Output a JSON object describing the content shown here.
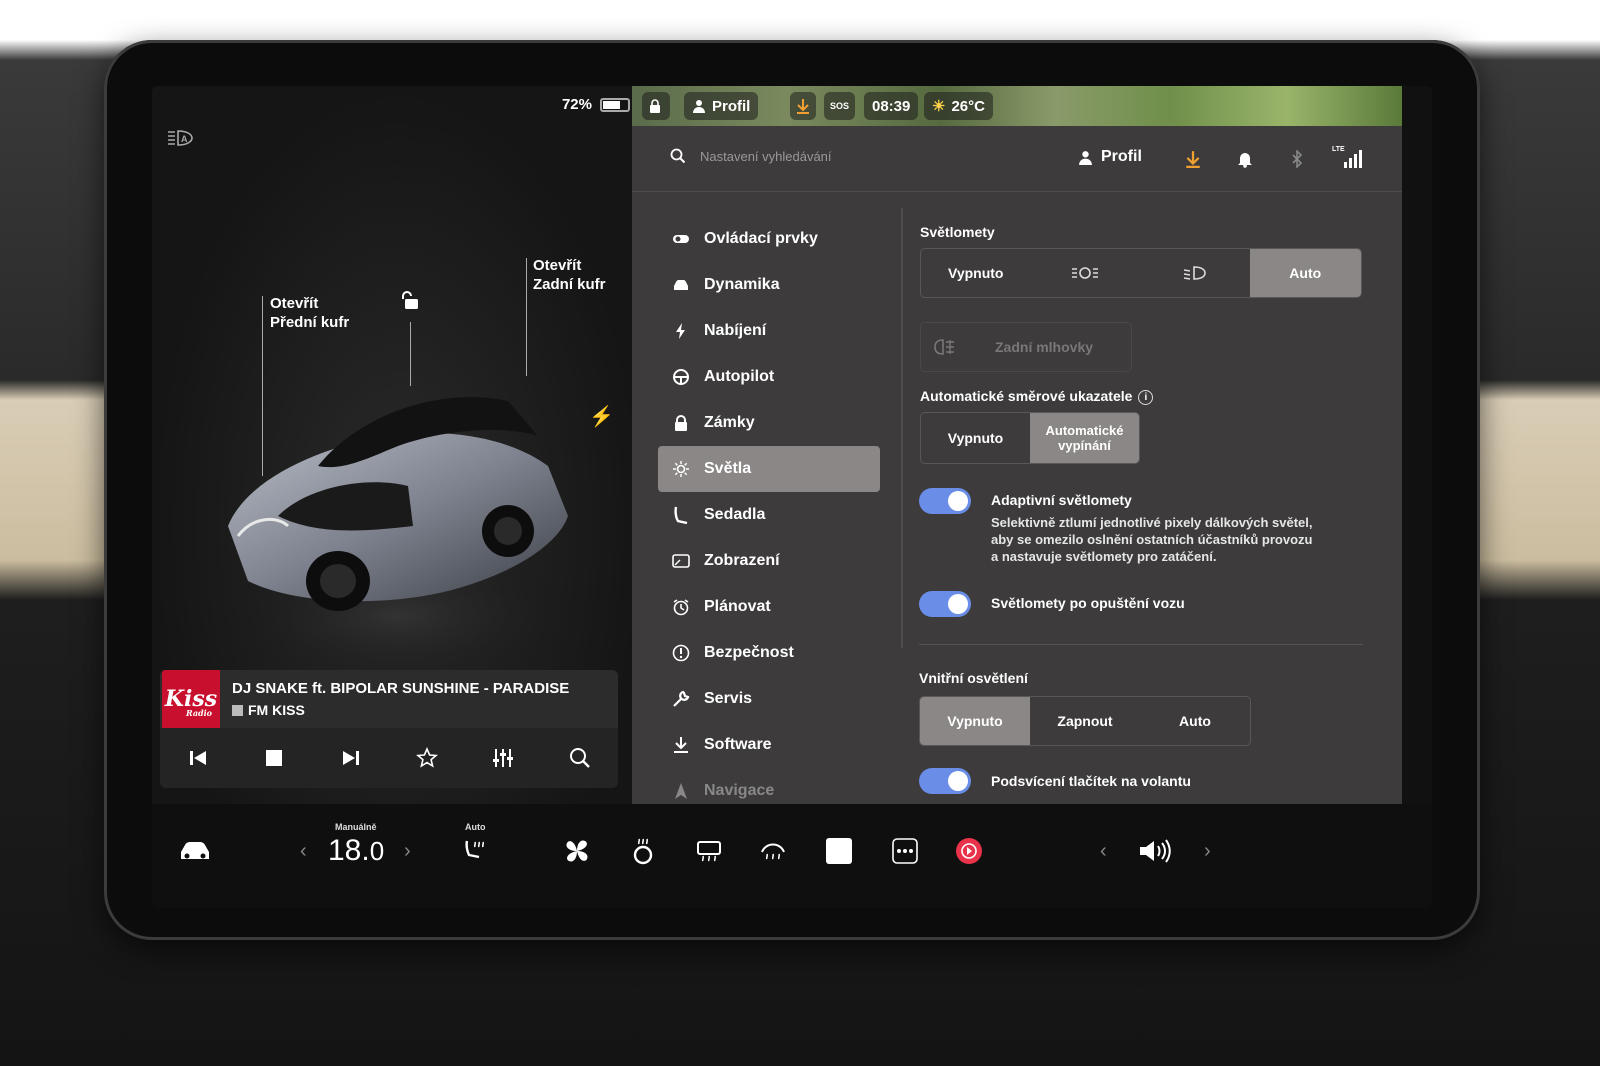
{
  "status": {
    "battery_percent_label": "72%",
    "battery_level": 0.72,
    "time": "08:39",
    "temperature": "26°C",
    "sos": "SOS",
    "profile_map": "Profil"
  },
  "car": {
    "front_trunk_line1": "Otevřít",
    "front_trunk_line2": "Přední kufr",
    "rear_trunk_line1": "Otevřít",
    "rear_trunk_line2": "Zadní kufr"
  },
  "media": {
    "art_text": "Kiss",
    "art_subtext": "Radio",
    "title": "DJ SNAKE ft. BIPOLAR SUNSHINE - PARADISE",
    "station": "FM KISS"
  },
  "topbar": {
    "search_placeholder": "Nastavení vyhledávání",
    "profile": "Profil",
    "lte": "LTE"
  },
  "menu": [
    {
      "label": "Ovládací prvky",
      "icon": "toggle-icon"
    },
    {
      "label": "Dynamika",
      "icon": "car-icon"
    },
    {
      "label": "Nabíjení",
      "icon": "bolt-icon"
    },
    {
      "label": "Autopilot",
      "icon": "steering-wheel-icon"
    },
    {
      "label": "Zámky",
      "icon": "lock-icon"
    },
    {
      "label": "Světla",
      "icon": "sun-icon"
    },
    {
      "label": "Sedadla",
      "icon": "seat-icon"
    },
    {
      "label": "Zobrazení",
      "icon": "display-icon"
    },
    {
      "label": "Plánovat",
      "icon": "clock-icon"
    },
    {
      "label": "Bezpečnost",
      "icon": "alert-icon"
    },
    {
      "label": "Servis",
      "icon": "wrench-icon"
    },
    {
      "label": "Software",
      "icon": "download-icon"
    },
    {
      "label": "Navigace",
      "icon": "navigation-icon"
    }
  ],
  "settings": {
    "headlights_label": "Světlomety",
    "headlights_off": "Vypnuto",
    "headlights_auto": "Auto",
    "rear_fog": "Zadní mlhovky",
    "auto_turn_label": "Automatické směrové ukazatele",
    "auto_turn_off": "Vypnuto",
    "auto_turn_auto_line1": "Automatické",
    "auto_turn_auto_line2": "vypínání",
    "adaptive_label": "Adaptivní světlomety",
    "adaptive_desc1": "Selektivně ztlumí jednotlivé pixely dálkových světel,",
    "adaptive_desc2": "aby se omezilo oslnění ostatních účastníků provozu",
    "adaptive_desc3": "a nastavuje světlomety pro zatáčení.",
    "exit_lights_label": "Světlomety po opuštění vozu",
    "interior_label": "Vnitřní osvětlení",
    "interior_off": "Vypnuto",
    "interior_on": "Zapnout",
    "interior_auto": "Auto",
    "steering_backlight_label": "Podsvícení tlačítek na volantu"
  },
  "bottom": {
    "mode": "Manuálně",
    "temperature_int": "18.",
    "temperature_dec": "0",
    "seat_mode": "Auto"
  }
}
